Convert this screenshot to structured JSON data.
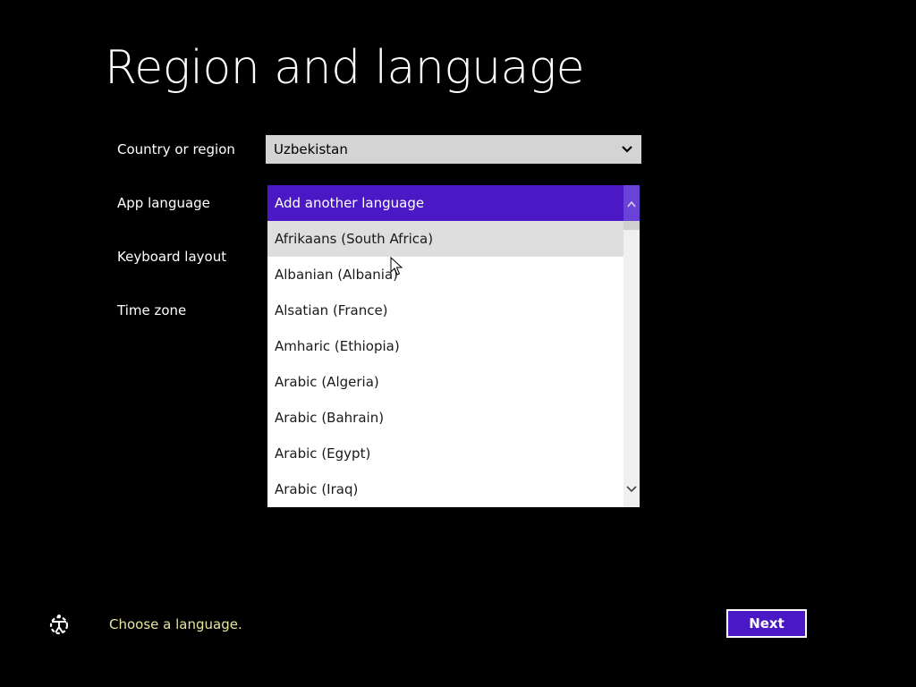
{
  "page": {
    "title": "Region and language"
  },
  "form": {
    "country_label": "Country or region",
    "country_value": "Uzbekistan",
    "app_language_label": "App language",
    "keyboard_label": "Keyboard layout",
    "timezone_label": "Time zone"
  },
  "language_list": {
    "options": [
      "Add another language",
      "Afrikaans (South Africa)",
      "Albanian (Albania)",
      "Alsatian (France)",
      "Amharic (Ethiopia)",
      "Arabic (Algeria)",
      "Arabic (Bahrain)",
      "Arabic (Egypt)",
      "Arabic (Iraq)"
    ],
    "selected_index": 0,
    "hover_index": 1
  },
  "footer": {
    "status_text": "Choose a language.",
    "next_label": "Next"
  },
  "icons": {
    "dropdown": "chevron-down-icon",
    "scroll_up": "chevron-up-icon",
    "scroll_down": "chevron-down-icon",
    "accessibility": "ease-of-access-icon",
    "cursor": "mouse-pointer-icon"
  },
  "colors": {
    "background": "#000000",
    "accent": "#4a18c4",
    "status_text": "#e6e6a0"
  }
}
